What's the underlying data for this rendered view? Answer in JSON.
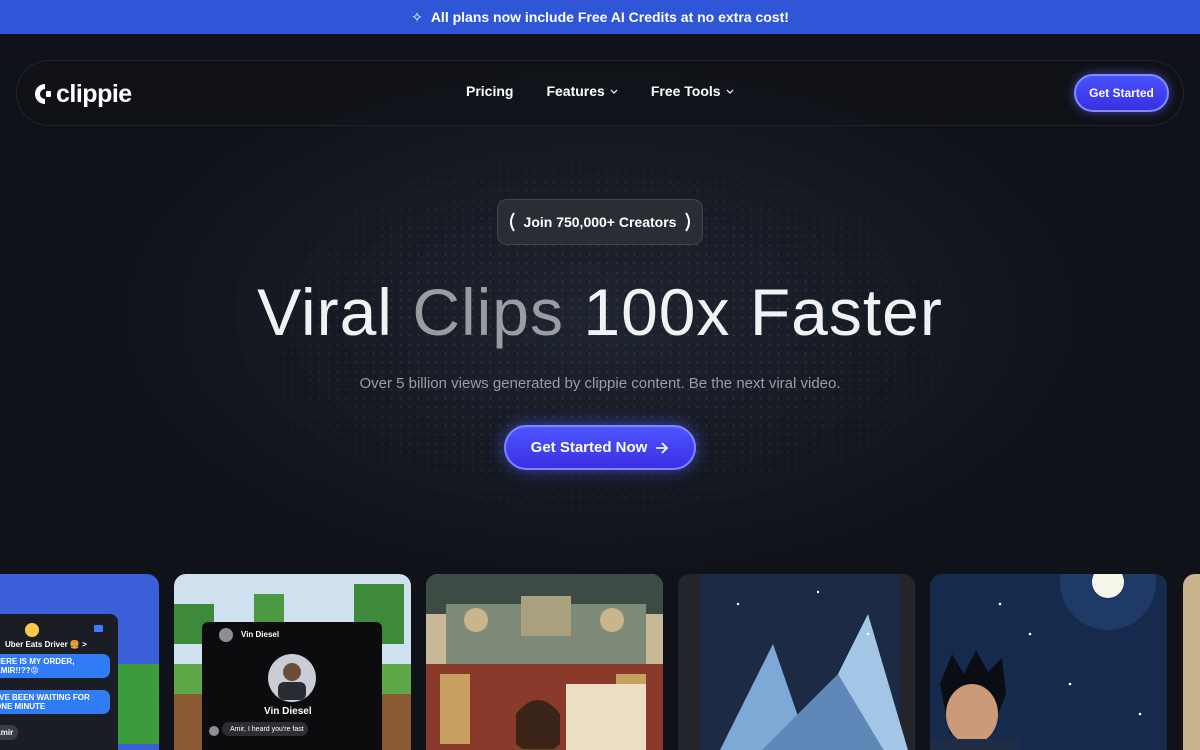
{
  "announcement": {
    "text": "All plans now include Free AI Credits at no extra cost!",
    "icon": "sparkle-icon"
  },
  "nav": {
    "logo": "clippie",
    "links": [
      {
        "label": "Pricing",
        "has_dropdown": false
      },
      {
        "label": "Features",
        "has_dropdown": true
      },
      {
        "label": "Free Tools",
        "has_dropdown": true
      }
    ],
    "cta": "Get Started"
  },
  "hero": {
    "badge": "Join 750,000+ Creators",
    "headline_words": [
      "Viral",
      "Clips",
      "100x",
      "Faster"
    ],
    "subline": "Over 5 billion views generated by clippie content. Be the next viral video.",
    "cta": "Get Started Now"
  },
  "cards": {
    "card1": {
      "contact": "Uber Eats Driver 🍔 >",
      "msg1": "HERE IS MY ORDER, AMIR!!??😡",
      "msg2": "I'VE BEEN WAITING FOR ONE MINUTE",
      "sender": "Amir"
    },
    "card2": {
      "contact": "Vin Diesel",
      "profile_name": "Vin Diesel",
      "message": "Amir, I heard you're fast"
    }
  },
  "colors": {
    "accent": "#4a52ff",
    "banner": "#2f56d6",
    "background": "#0f1218"
  }
}
